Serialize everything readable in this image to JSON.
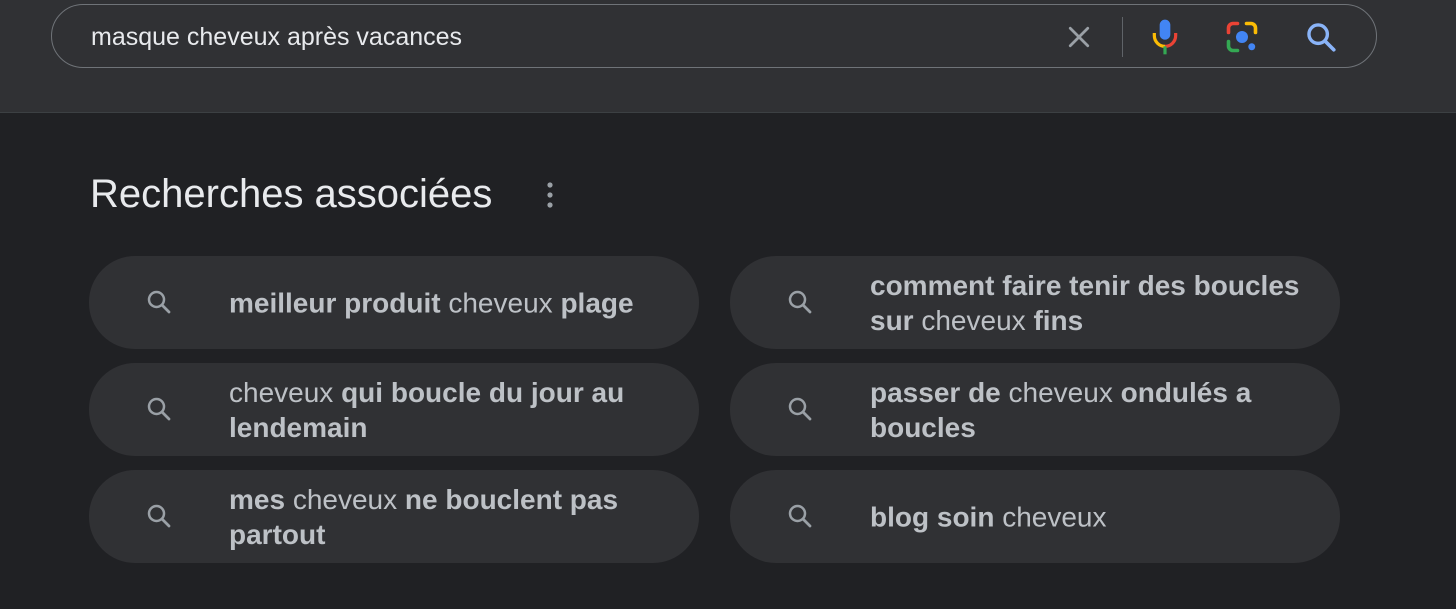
{
  "search": {
    "query": "masque cheveux après vacances",
    "icons": [
      "close-icon",
      "microphone-icon",
      "lens-icon",
      "search-icon"
    ]
  },
  "related": {
    "title": "Recherches associées",
    "items": [
      {
        "segments": [
          {
            "text": "meilleur produit",
            "bold": true
          },
          {
            "text": " cheveux ",
            "bold": false
          },
          {
            "text": "plage",
            "bold": true
          }
        ]
      },
      {
        "segments": [
          {
            "text": "comment faire tenir des boucles sur",
            "bold": true
          },
          {
            "text": " cheveux ",
            "bold": false
          },
          {
            "text": "fins",
            "bold": true
          }
        ]
      },
      {
        "segments": [
          {
            "text": "cheveux ",
            "bold": false
          },
          {
            "text": "qui boucle du jour au lendemain",
            "bold": true
          }
        ]
      },
      {
        "segments": [
          {
            "text": "passer de",
            "bold": true
          },
          {
            "text": " cheveux ",
            "bold": false
          },
          {
            "text": "ondulés a boucles",
            "bold": true
          }
        ]
      },
      {
        "segments": [
          {
            "text": "mes",
            "bold": true
          },
          {
            "text": " cheveux ",
            "bold": false
          },
          {
            "text": "ne bouclent pas partout",
            "bold": true
          }
        ]
      },
      {
        "segments": [
          {
            "text": "blog soin",
            "bold": true
          },
          {
            "text": " cheveux",
            "bold": false
          }
        ]
      }
    ]
  },
  "colors": {
    "background": "#202124",
    "header": "#303134",
    "chip": "#303134",
    "text": "#e8eaed",
    "chip_text": "#bdc1c6",
    "icon_gray": "#9aa0a6",
    "search_blue": "#8ab4f8"
  }
}
